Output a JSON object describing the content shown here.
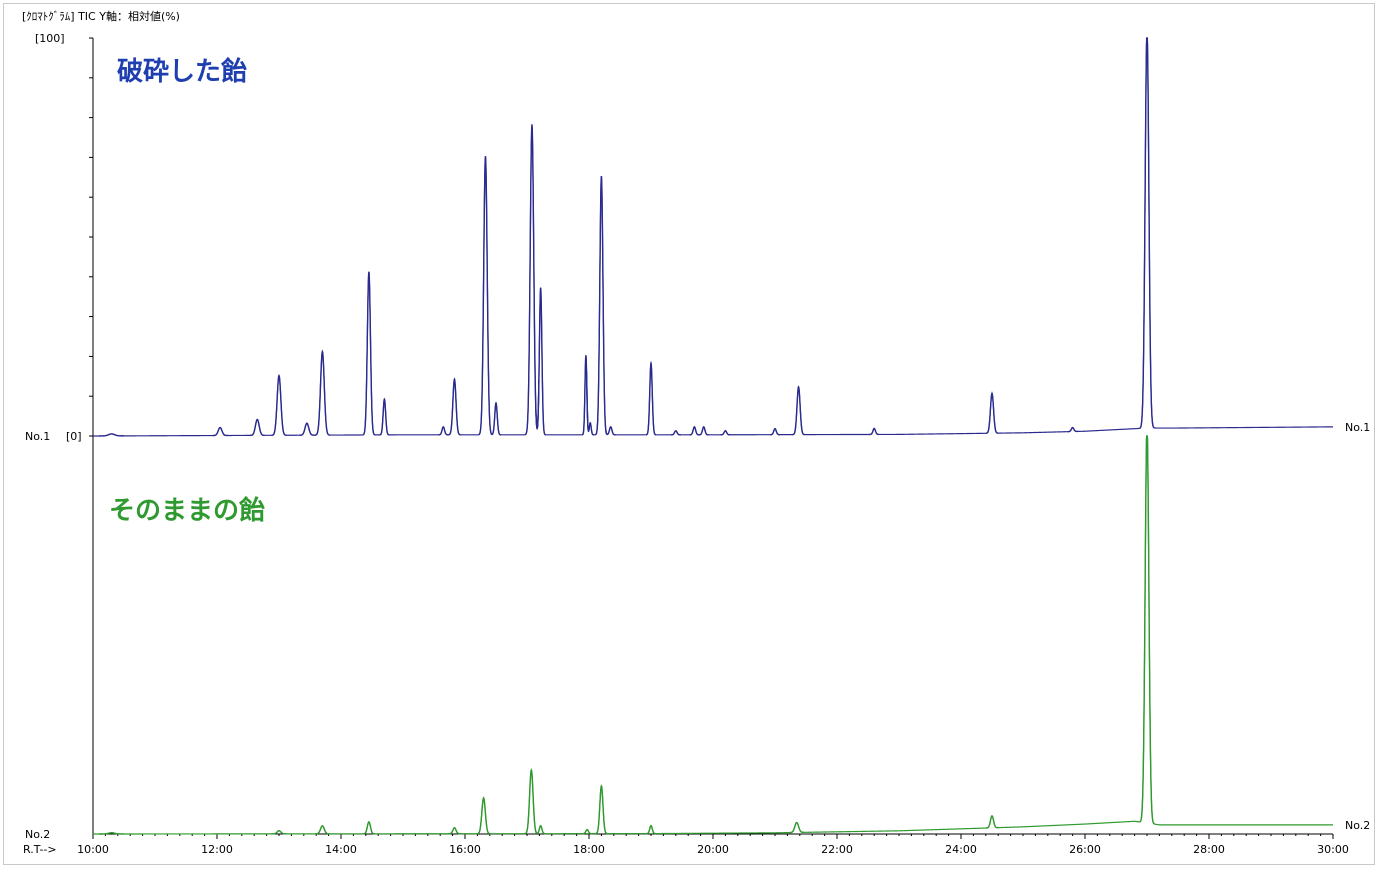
{
  "header": {
    "title": "[ｸﾛﾏﾄｸﾞﾗﾑ]  TIC  Y軸：相対値(%)"
  },
  "axis": {
    "y_top_label": "[100]",
    "y_zero_label": "[0]",
    "rt_label": "R.T-->"
  },
  "colors": {
    "series1": "#2b2b8f",
    "series2": "#2f9a2f",
    "label1": "#1f3fb0",
    "label2": "#2f9a2f"
  },
  "chart_data": {
    "type": "line",
    "xlim": [
      10,
      30
    ],
    "x_ticks": [
      "10:00",
      "12:00",
      "14:00",
      "16:00",
      "18:00",
      "20:00",
      "22:00",
      "24:00",
      "26:00",
      "28:00",
      "30:00"
    ],
    "ylim": [
      0,
      100
    ],
    "series": [
      {
        "name": "No.1",
        "title": "破砕した飴",
        "baseline": [
          [
            10,
            0
          ],
          [
            15,
            0.3
          ],
          [
            20,
            0.3
          ],
          [
            23,
            0.4
          ],
          [
            25,
            0.8
          ],
          [
            26,
            1.2
          ],
          [
            27,
            2
          ],
          [
            27.5,
            2
          ],
          [
            30,
            2.3
          ]
        ],
        "peaks": [
          [
            10.3,
            0.5,
            0.05
          ],
          [
            12.05,
            2,
            0.03
          ],
          [
            12.65,
            4,
            0.03
          ],
          [
            13.0,
            15,
            0.03
          ],
          [
            13.45,
            3,
            0.03
          ],
          [
            13.7,
            21,
            0.03
          ],
          [
            14.45,
            41,
            0.025
          ],
          [
            14.7,
            9,
            0.02
          ],
          [
            15.65,
            2,
            0.02
          ],
          [
            15.83,
            14,
            0.025
          ],
          [
            16.33,
            70,
            0.028
          ],
          [
            16.5,
            8,
            0.02
          ],
          [
            17.08,
            78,
            0.028
          ],
          [
            17.22,
            37,
            0.02
          ],
          [
            17.95,
            20,
            0.015
          ],
          [
            18.02,
            3,
            0.015
          ],
          [
            18.2,
            65,
            0.025
          ],
          [
            18.35,
            2,
            0.02
          ],
          [
            19.0,
            18,
            0.02
          ],
          [
            19.4,
            1,
            0.02
          ],
          [
            19.7,
            2,
            0.02
          ],
          [
            19.85,
            2,
            0.02
          ],
          [
            20.2,
            1,
            0.02
          ],
          [
            21.0,
            1.5,
            0.02
          ],
          [
            21.38,
            12,
            0.025
          ],
          [
            22.6,
            1.5,
            0.02
          ],
          [
            24.5,
            10,
            0.025
          ],
          [
            25.8,
            1,
            0.02
          ],
          [
            27.0,
            100,
            0.03
          ]
        ]
      },
      {
        "name": "No.2",
        "title": "そのままの飴",
        "baseline": [
          [
            10,
            0
          ],
          [
            19,
            0.1
          ],
          [
            21,
            0.3
          ],
          [
            23,
            0.8
          ],
          [
            25,
            1.8
          ],
          [
            26,
            2.5
          ],
          [
            26.8,
            3.2
          ],
          [
            27.2,
            2.3
          ],
          [
            30,
            2.3
          ]
        ],
        "peaks": [
          [
            10.3,
            0.3,
            0.05
          ],
          [
            13.0,
            0.8,
            0.03
          ],
          [
            13.7,
            2,
            0.03
          ],
          [
            14.45,
            3,
            0.025
          ],
          [
            15.83,
            1.5,
            0.025
          ],
          [
            16.3,
            9,
            0.028
          ],
          [
            17.07,
            16,
            0.028
          ],
          [
            17.22,
            2,
            0.02
          ],
          [
            17.97,
            1,
            0.02
          ],
          [
            18.2,
            12,
            0.025
          ],
          [
            19.0,
            2,
            0.02
          ],
          [
            21.35,
            2.5,
            0.03
          ],
          [
            24.5,
            3,
            0.025
          ],
          [
            27.0,
            100,
            0.03
          ]
        ]
      }
    ]
  }
}
